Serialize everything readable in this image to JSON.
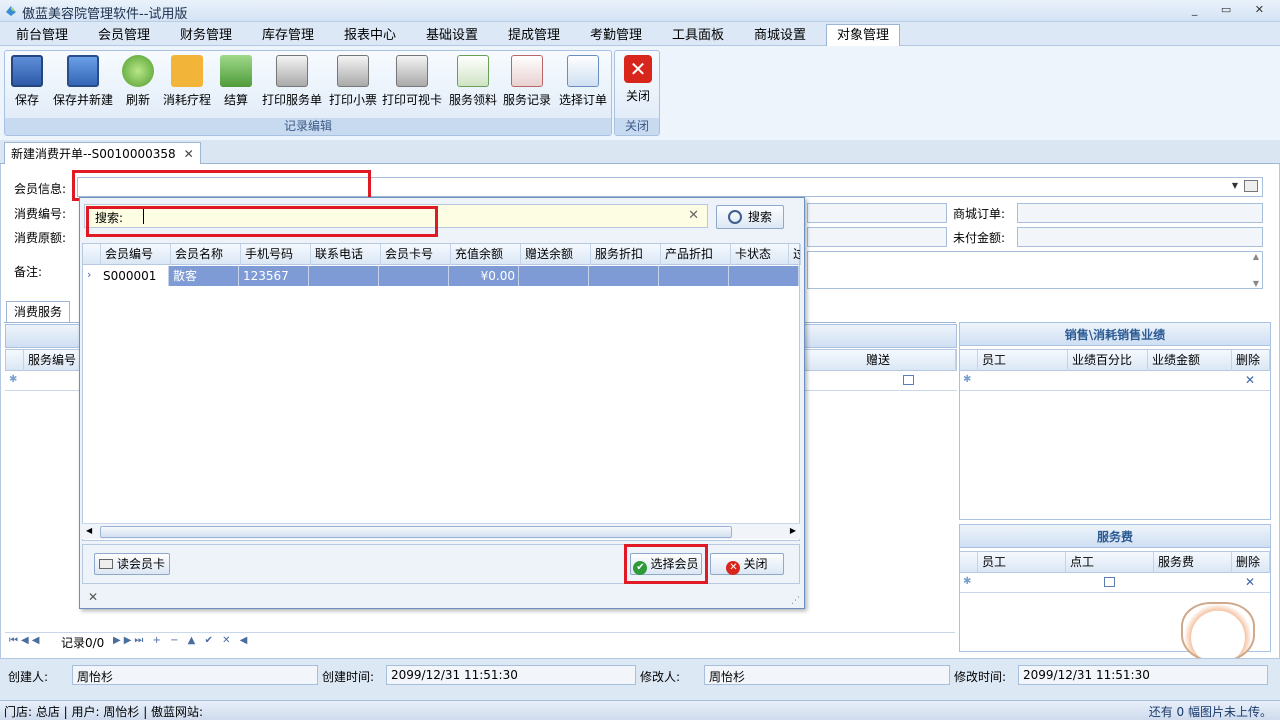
{
  "window": {
    "title": "傲蓝美容院管理软件--试用版",
    "controls": "_ ▭ ✕"
  },
  "menu": [
    "前台管理",
    "会员管理",
    "财务管理",
    "库存管理",
    "报表中心",
    "基础设置",
    "提成管理",
    "考勤管理",
    "工具面板",
    "商城设置",
    "对象管理"
  ],
  "ribbon": {
    "group1_label": "记录编辑",
    "group2_label": "关闭",
    "buttons": [
      {
        "label": "保存",
        "icon": "save-icon"
      },
      {
        "label": "保存并新建",
        "icon": "save-new-icon"
      },
      {
        "label": "刷新",
        "icon": "refresh-icon"
      },
      {
        "label": "消耗疗程",
        "icon": "puzzle-icon"
      },
      {
        "label": "结算",
        "icon": "cash-icon"
      },
      {
        "label": "打印服务单",
        "icon": "printer-icon"
      },
      {
        "label": "打印小票",
        "icon": "printer-icon"
      },
      {
        "label": "打印可视卡",
        "icon": "printer-icon"
      },
      {
        "label": "服务领料",
        "icon": "material-icon"
      },
      {
        "label": "服务记录",
        "icon": "calendar-icon"
      },
      {
        "label": "选择订单",
        "icon": "order-icon"
      }
    ],
    "close_label": "关闭"
  },
  "doc_tab": {
    "label": "新建消费开单--S0010000358",
    "close": "✕"
  },
  "form": {
    "member_info": "会员信息:",
    "consume_no": "消费编号:",
    "original_price": "消费原额:",
    "remark": "备注:",
    "mall_order": "商城订单:",
    "unpaid": "未付金额:"
  },
  "popup": {
    "search_label": "搜索:",
    "search_value": "",
    "clear": "✕",
    "search_button": "搜索",
    "columns": [
      "会员编号",
      "会员名称",
      "手机号码",
      "联系电话",
      "会员卡号",
      "充值余额",
      "赠送余额",
      "服务折扣",
      "产品折扣",
      "卡状态",
      "过"
    ],
    "rows": [
      [
        "S000001",
        "散客",
        "123567",
        "",
        "",
        "¥0.00",
        "",
        "",
        "",
        "",
        ""
      ]
    ],
    "read_card": "读会员卡",
    "select_member": "选择会员",
    "close": "关闭",
    "footer_close": "✕"
  },
  "service_tab": "消费服务",
  "service_grid": {
    "col_no": "服务编号",
    "col_gift": "赠送"
  },
  "sales_panel": {
    "title": "销售\\消耗销售业绩",
    "columns": [
      "员工",
      "业绩百分比",
      "业绩金额",
      "删除"
    ]
  },
  "fee_panel": {
    "title": "服务费",
    "columns": [
      "员工",
      "点工",
      "服务费",
      "删除"
    ]
  },
  "nav": {
    "record": "记录0/0"
  },
  "bottom": {
    "creator_label": "创建人:",
    "creator": "周怡杉",
    "created_label": "创建时间:",
    "created": "2099/12/31 11:51:30",
    "modifier_label": "修改人:",
    "modifier": "周怡杉",
    "modified_label": "修改时间:",
    "modified": "2099/12/31 11:51:30"
  },
  "status": {
    "left": "门店: 总店  | 用户: 周怡杉  | 傲蓝网站:",
    "right": "还有 0 幅图片未上传。"
  }
}
